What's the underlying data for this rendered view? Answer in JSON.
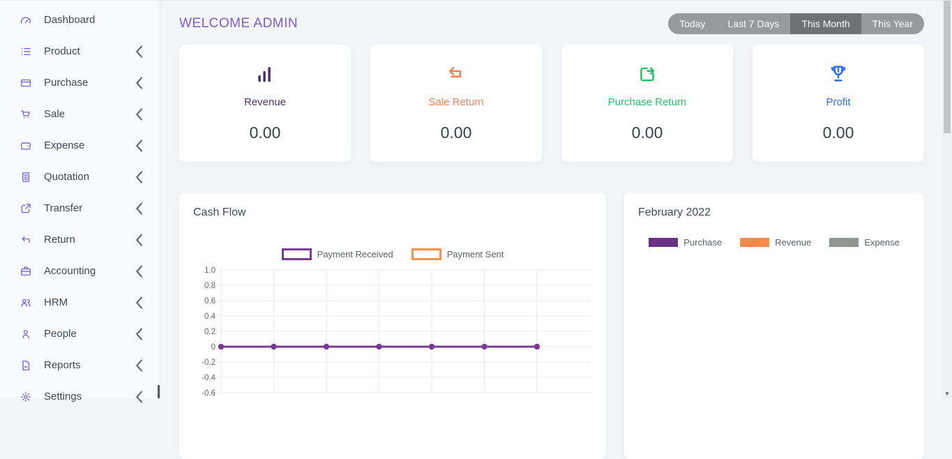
{
  "theme": {
    "sidebar_icon_color": "#7b6ad2",
    "welcome_title_color": "#7e5ec5"
  },
  "header": {
    "title": "WELCOME ADMIN",
    "filters": [
      {
        "label": "Today",
        "active": false
      },
      {
        "label": "Last 7 Days",
        "active": false
      },
      {
        "label": "This Month",
        "active": true
      },
      {
        "label": "This Year",
        "active": false
      }
    ]
  },
  "sidebar": {
    "submenu_indicator": "chevron-left-icon",
    "items": [
      {
        "label": "Dashboard",
        "icon": "dashboard-gauge-icon",
        "has_submenu": false
      },
      {
        "label": "Product",
        "icon": "list-icon",
        "has_submenu": true
      },
      {
        "label": "Purchase",
        "icon": "credit-card-icon",
        "has_submenu": true
      },
      {
        "label": "Sale",
        "icon": "cart-icon",
        "has_submenu": true
      },
      {
        "label": "Expense",
        "icon": "wallet-icon",
        "has_submenu": true
      },
      {
        "label": "Quotation",
        "icon": "document-icon",
        "has_submenu": true
      },
      {
        "label": "Transfer",
        "icon": "share-box-icon",
        "has_submenu": true
      },
      {
        "label": "Return",
        "icon": "undo-arrow-icon",
        "has_submenu": true
      },
      {
        "label": "Accounting",
        "icon": "briefcase-icon",
        "has_submenu": true
      },
      {
        "label": "HRM",
        "icon": "users-icon",
        "has_submenu": true
      },
      {
        "label": "People",
        "icon": "person-icon",
        "has_submenu": true
      },
      {
        "label": "Reports",
        "icon": "report-file-icon",
        "has_submenu": true
      },
      {
        "label": "Settings",
        "icon": "gear-icon",
        "has_submenu": true
      }
    ]
  },
  "stats": [
    {
      "label": "Revenue",
      "value": "0.00",
      "color": "#5e2d79",
      "icon": "bar-chart-icon",
      "icon_color": "#4b2a69"
    },
    {
      "label": "Sale Return",
      "value": "0.00",
      "color": "#f97d57",
      "icon": "return-arrow-icon",
      "icon_color": "#f97d57"
    },
    {
      "label": "Purchase Return",
      "value": "0.00",
      "color": "#27bf68",
      "icon": "share-return-icon",
      "icon_color": "#27bf68"
    },
    {
      "label": "Profit",
      "value": "0.00",
      "color": "#2f6bf0",
      "icon": "trophy-icon",
      "icon_color": "#2f6bf0"
    }
  ],
  "chart_data": [
    {
      "name": "cash_flow",
      "type": "line",
      "title": "Cash Flow",
      "legend_position": "top",
      "grid": true,
      "yticks": [
        "1.0",
        "0.8",
        "0.6",
        "0.4",
        "0.2",
        "0",
        "-0.2",
        "-0.4",
        "-0.6"
      ],
      "ylim_visible": [
        -0.6,
        1.0
      ],
      "x_labels_visible": false,
      "series": [
        {
          "name": "Payment Received",
          "color": "#7a3b96",
          "values": [
            0,
            0,
            0,
            0,
            0,
            0,
            0
          ]
        },
        {
          "name": "Payment Sent",
          "color": "#f2934e",
          "values": []
        }
      ]
    },
    {
      "name": "monthly_overview",
      "type": "bar",
      "title": "February 2022",
      "legend_position": "top",
      "series": [
        {
          "name": "Purchase",
          "color": "#6a3085",
          "values": []
        },
        {
          "name": "Revenue",
          "color": "#f98a4a",
          "values": []
        },
        {
          "name": "Expense",
          "color": "#8e978f",
          "values": []
        }
      ]
    }
  ]
}
